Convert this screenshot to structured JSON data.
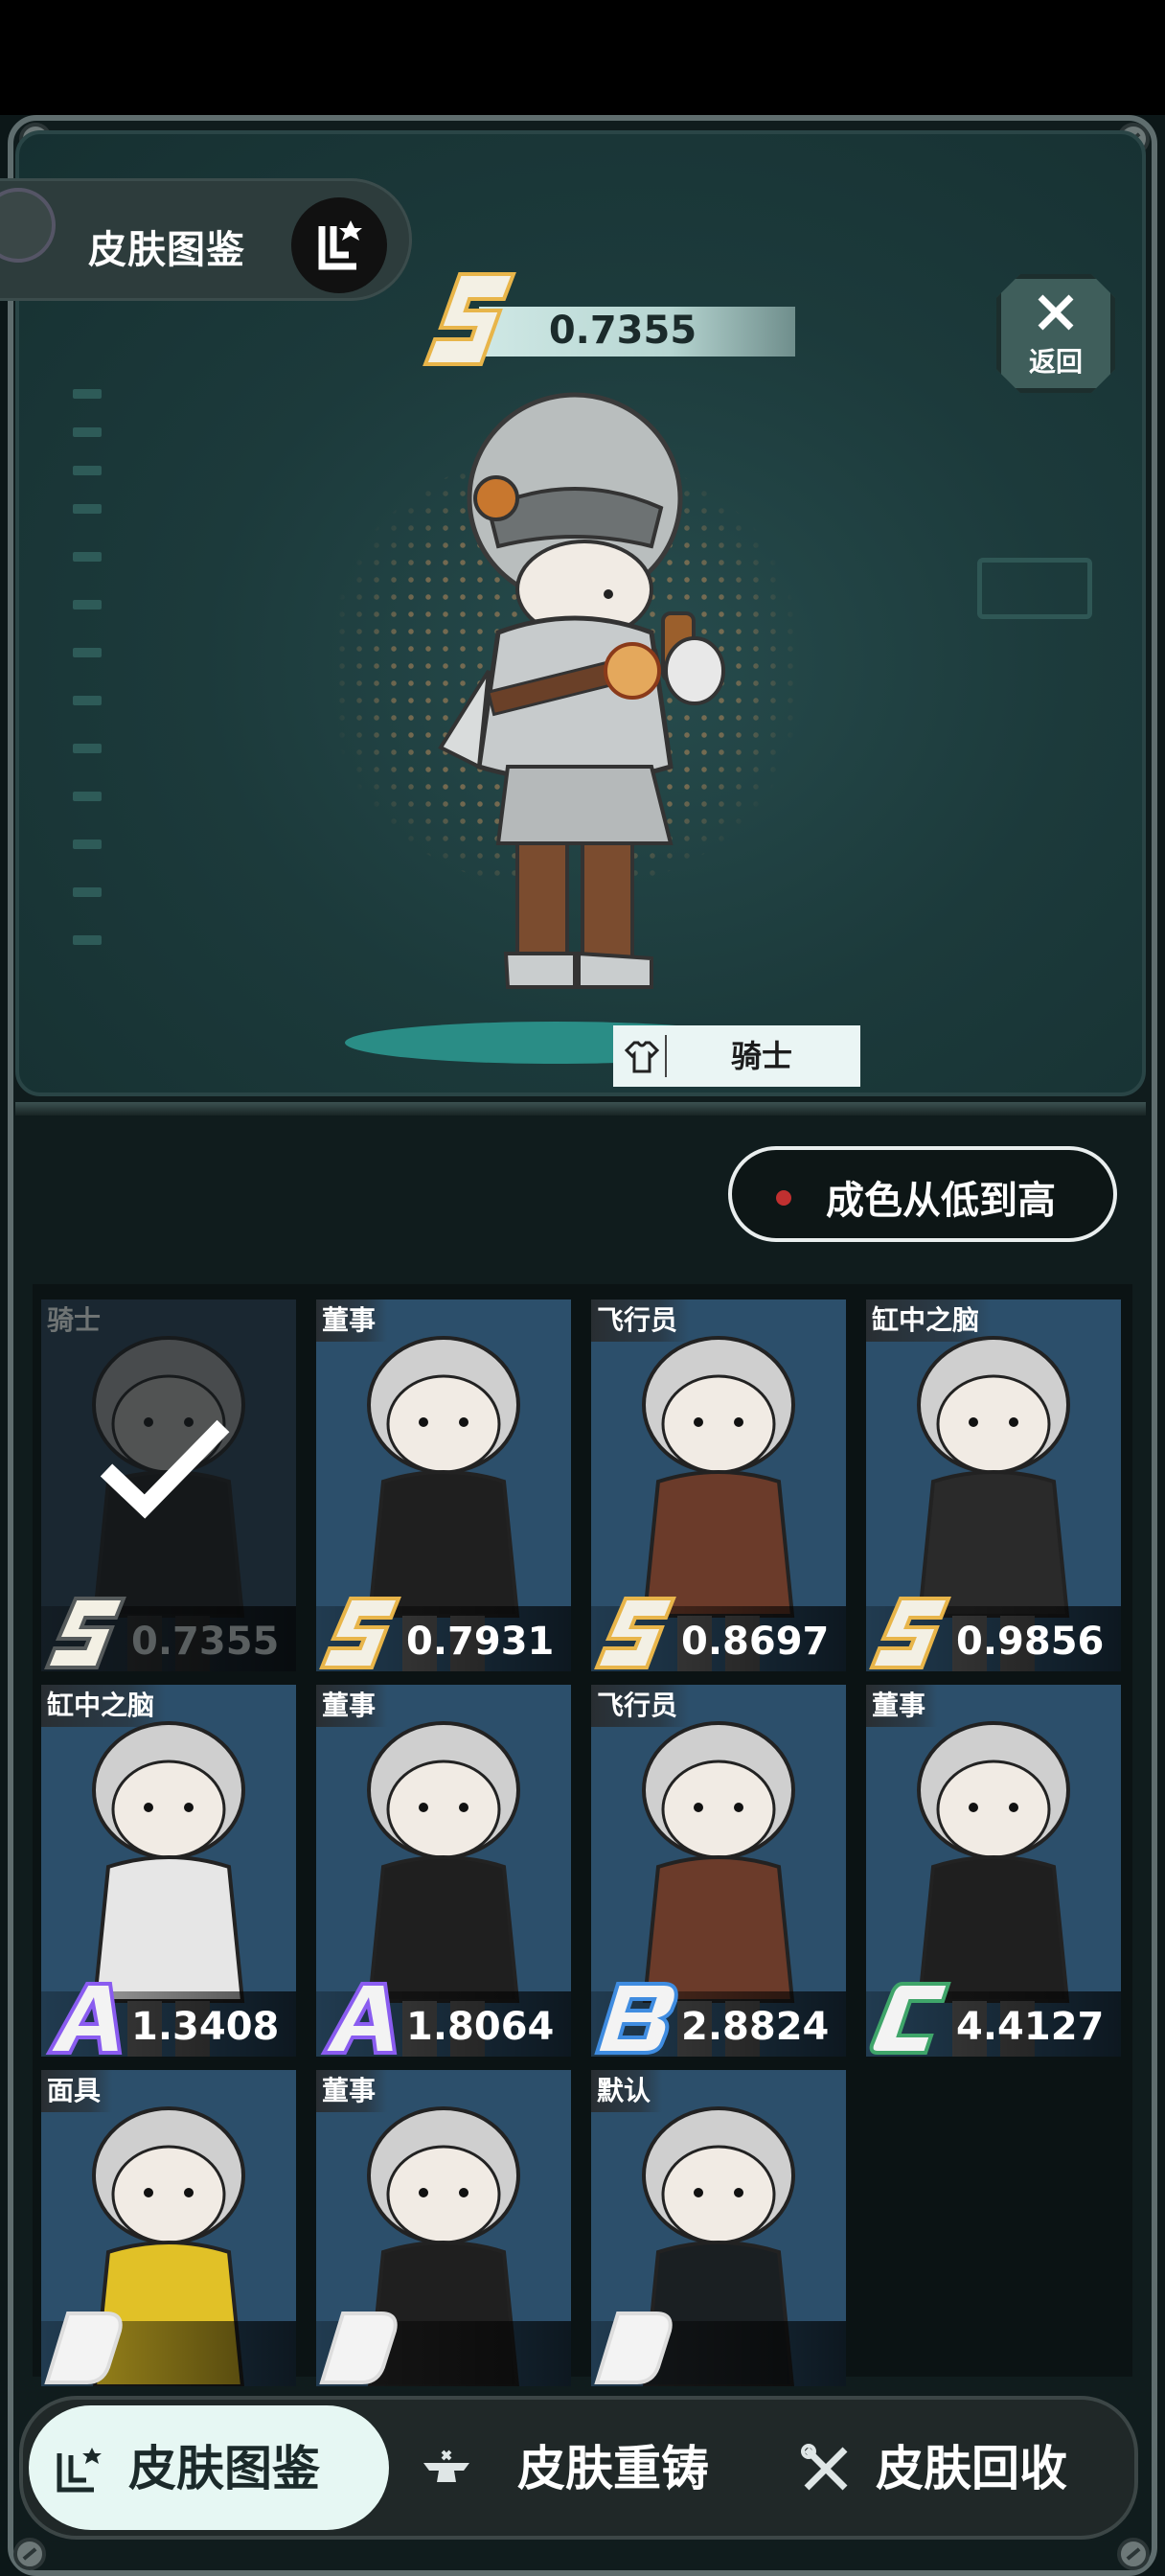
{
  "header": {
    "title": "皮肤图鉴",
    "return_label": "返回"
  },
  "showcase": {
    "currency_grade": "S",
    "value": "0.7355",
    "skin_name": "骑士"
  },
  "sort": {
    "label": "成色从低到高"
  },
  "skins": [
    {
      "name": "骑士",
      "grade": "S",
      "value": "0.7355",
      "selected": true
    },
    {
      "name": "董事",
      "grade": "S",
      "value": "0.7931"
    },
    {
      "name": "飞行员",
      "grade": "S",
      "value": "0.8697"
    },
    {
      "name": "缸中之脑",
      "grade": "S",
      "value": "0.9856"
    },
    {
      "name": "缸中之脑",
      "grade": "A",
      "value": "1.3408"
    },
    {
      "name": "董事",
      "grade": "A",
      "value": "1.8064"
    },
    {
      "name": "飞行员",
      "grade": "B",
      "value": "2.8824"
    },
    {
      "name": "董事",
      "grade": "C",
      "value": "4.4127"
    },
    {
      "name": "面具",
      "grade": "D",
      "value": ""
    },
    {
      "name": "董事",
      "grade": "D",
      "value": ""
    },
    {
      "name": "默认",
      "grade": "D",
      "value": ""
    }
  ],
  "tabs": [
    {
      "label": "皮肤图鉴",
      "active": true
    },
    {
      "label": "皮肤重铸"
    },
    {
      "label": "皮肤回收"
    }
  ],
  "colors": {
    "accent": "#e6f7f3",
    "grade_S": "#e8b54a",
    "grade_A": "#8a5cf0",
    "grade_B": "#3f8ce0",
    "grade_C": "#3fa56a",
    "card_bg": "#2c4f6b"
  }
}
